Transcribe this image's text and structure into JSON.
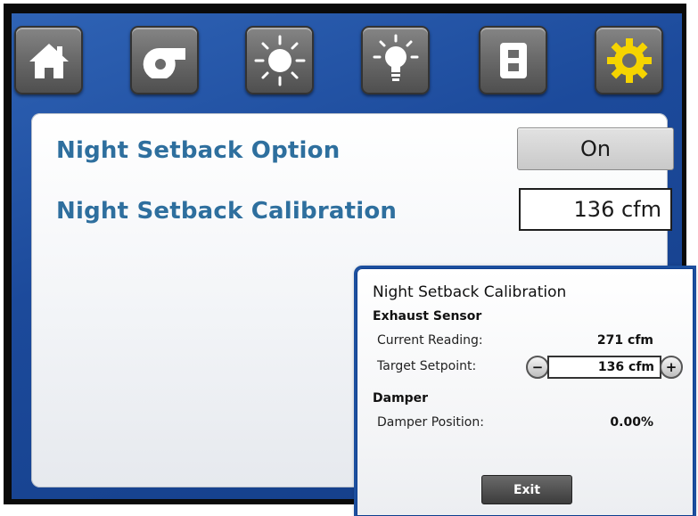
{
  "toolbar": {
    "icons": [
      {
        "name": "home-icon"
      },
      {
        "name": "fan-icon"
      },
      {
        "name": "sun-icon"
      },
      {
        "name": "light-bulb-icon"
      },
      {
        "name": "door-icon"
      },
      {
        "name": "gear-icon",
        "color": "#f5d400"
      }
    ]
  },
  "settings": {
    "night_setback_option": {
      "label": "Night Setback Option",
      "value": "On"
    },
    "night_setback_calibration": {
      "label": "Night Setback Calibration",
      "value": "136 cfm"
    }
  },
  "popup": {
    "title": "Night Setback Calibration",
    "exhaust_sensor": {
      "heading": "Exhaust Sensor",
      "current_reading_label": "Current Reading:",
      "current_reading_value": "271 cfm",
      "target_setpoint_label": "Target Setpoint:",
      "target_setpoint_value": "136 cfm",
      "decrement": "−",
      "increment": "+"
    },
    "damper": {
      "heading": "Damper",
      "position_label": "Damper Position:",
      "position_value": "0.00%"
    },
    "exit_label": "Exit"
  },
  "colors": {
    "background_blue": "#1c4a9b",
    "label_blue": "#2e6f9e",
    "gear_yellow": "#f5d400"
  }
}
